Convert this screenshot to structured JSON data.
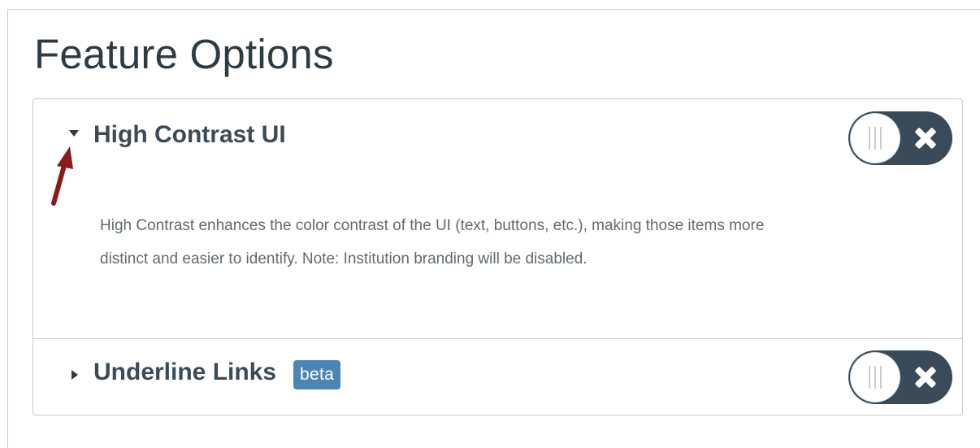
{
  "page": {
    "title": "Feature Options"
  },
  "features": [
    {
      "title": "High Contrast UI",
      "expanded": true,
      "description": "High Contrast enhances the color contrast of the UI (text, buttons, etc.), making those items more distinct and easier to identify. Note: Institution branding will be disabled.",
      "enabled": false
    },
    {
      "title": "Underline Links",
      "badge": "beta",
      "expanded": false,
      "enabled": false
    }
  ],
  "icons": {
    "expanded_caret": "caret-down-icon",
    "collapsed_caret": "caret-right-icon",
    "toggle_off": "x-icon",
    "annotation": "red-arrow-icon"
  },
  "colors": {
    "text": "#2d3b45",
    "toggle_bg": "#394b58",
    "badge_bg": "#4a86b4",
    "annotation_arrow": "#8b1a1a"
  }
}
